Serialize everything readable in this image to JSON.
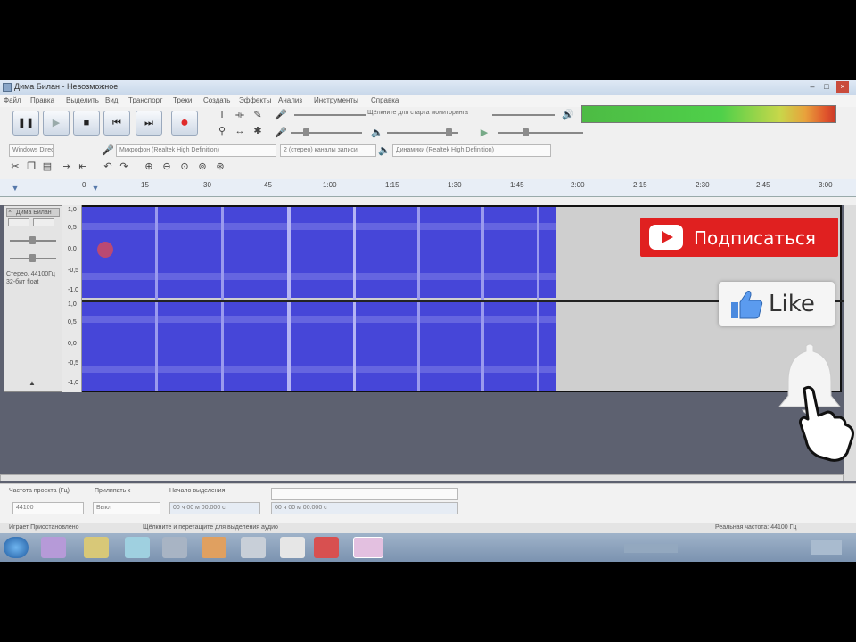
{
  "window": {
    "title": "Дима Билан - Невозможное",
    "menu": [
      "Файл",
      "Правка",
      "Выделить",
      "Вид",
      "Транспорт",
      "Треки",
      "Создать",
      "Эффекты",
      "Анализ",
      "Инструменты",
      "Справка"
    ]
  },
  "toolbar": {
    "monitor_prompt": "Щёлкните для старта мониторинга",
    "host_combo": "Windows DirectSound",
    "recording_device": "Микрофон (Realtek High Definition)",
    "channels_combo": "2 (стерео) каналы записи",
    "playback_device": "Динамики (Realtek High Definition)"
  },
  "ruler": {
    "ticks": [
      "0",
      "15",
      "30",
      "45",
      "1:00",
      "1:15",
      "1:30",
      "1:45",
      "2:00",
      "2:15",
      "2:30",
      "2:45",
      "3:00"
    ]
  },
  "track": {
    "name": "Дима Билан",
    "info": "Стерео, 44100Гц 32-бит float",
    "scale_top": [
      "1,0",
      "0,5",
      "0,0",
      "-0,5",
      "-1,0"
    ],
    "scale_bottom": [
      "1,0",
      "0,5",
      "0,0",
      "-0,5",
      "-1,0"
    ]
  },
  "selection_bar": {
    "rate_label": "Частота проекта (Гц)",
    "rate_value": "44100",
    "snap_label": "Прилипать к",
    "snap_value": "Выкл",
    "start_label": "Начало выделения",
    "start_value": "00 ч 00 м 00.000 с",
    "end_value": "00 ч 00 м 00.000 с"
  },
  "status": {
    "left": "Играет Приостановлено",
    "middle": "Щёлкните и перетащите для выделения аудио",
    "right": "Реальная частота: 44100 Гц"
  },
  "overlay": {
    "subscribe_label": "Подписаться",
    "like_label": "Like"
  },
  "colors": {
    "waveform": "#4646d8",
    "subscribe_bg": "#e02020",
    "record": "#e02a2a"
  }
}
